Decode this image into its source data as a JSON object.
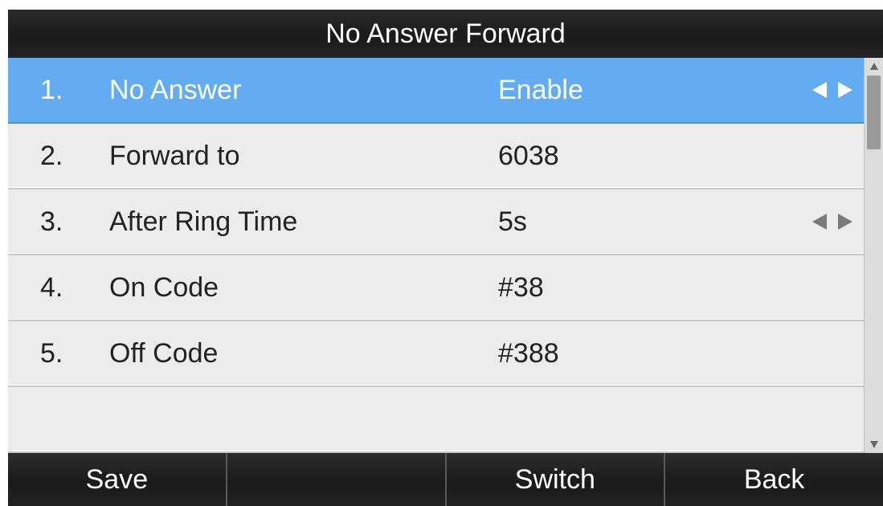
{
  "title": "No Answer Forward",
  "rows": [
    {
      "number": "1.",
      "label": "No Answer",
      "value": "Enable",
      "has_arrows": true,
      "selected": true
    },
    {
      "number": "2.",
      "label": "Forward to",
      "value": "6038",
      "has_arrows": false,
      "selected": false
    },
    {
      "number": "3.",
      "label": "After Ring Time",
      "value": "5s",
      "has_arrows": true,
      "selected": false
    },
    {
      "number": "4.",
      "label": "On Code",
      "value": "#38",
      "has_arrows": false,
      "selected": false
    },
    {
      "number": "5.",
      "label": "Off Code",
      "value": "#388",
      "has_arrows": false,
      "selected": false
    }
  ],
  "softkeys": [
    "Save",
    "",
    "Switch",
    "Back"
  ],
  "icons": {
    "arrow_left": "left-arrow-icon",
    "arrow_right": "right-arrow-icon",
    "scroll_up": "scroll-up-icon",
    "scroll_down": "scroll-down-icon"
  },
  "colors": {
    "selected_row": "#64acf2",
    "title_bar": "#1f1f1f",
    "list_background": "#ececec"
  }
}
